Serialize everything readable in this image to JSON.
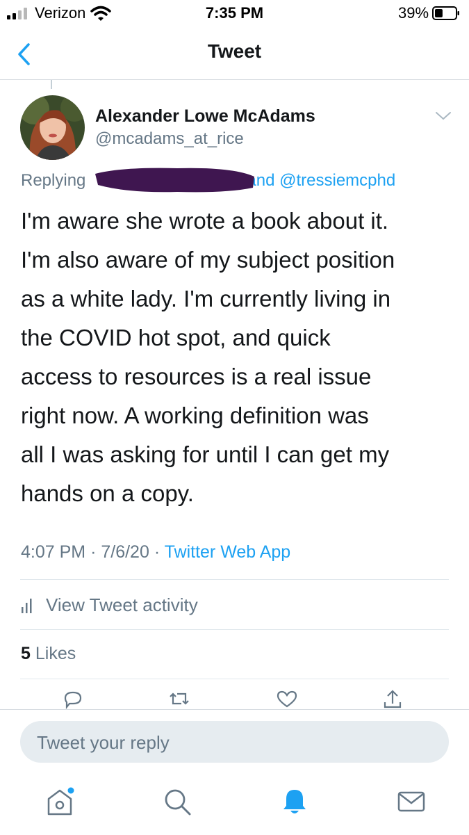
{
  "status_bar": {
    "carrier": "Verizon",
    "time": "7:35 PM",
    "battery_percent": "39%",
    "battery_level": 0.39
  },
  "nav": {
    "title": "Tweet",
    "back_icon": "chevron-left-icon"
  },
  "tweet": {
    "author_name": "Alexander Lowe McAdams",
    "author_handle": "@mcadams_at_rice",
    "replying_prefix": "Replying",
    "replying_suffix": "and",
    "replying_mention": "@tressiemcphd",
    "text_lines": [
      "I'm aware she wrote a book about it.",
      "I'm also aware of my subject position",
      "as a white lady. I'm currently living in",
      "the COVID hot spot, and quick",
      "access to resources is a real issue",
      "right now. A working definition was",
      "all I was asking for until I can get my",
      "hands on a copy."
    ],
    "time": "4:07 PM",
    "separator": "·",
    "date": "7/6/20",
    "source": "Twitter Web App"
  },
  "activity": {
    "label": "View Tweet activity",
    "icon": "bar-chart-icon"
  },
  "stats": {
    "likes_count": "5",
    "likes_label": "Likes"
  },
  "actions": [
    "reply-icon",
    "retweet-icon",
    "like-icon",
    "share-icon"
  ],
  "reply_box": {
    "placeholder": "Tweet your reply"
  },
  "tab_bar": [
    "home-icon",
    "search-icon",
    "notifications-icon",
    "messages-icon"
  ],
  "colors": {
    "accent": "#1da1f2",
    "secondary_text": "#657786",
    "primary_text": "#14171a",
    "redaction": "#3f1650"
  }
}
